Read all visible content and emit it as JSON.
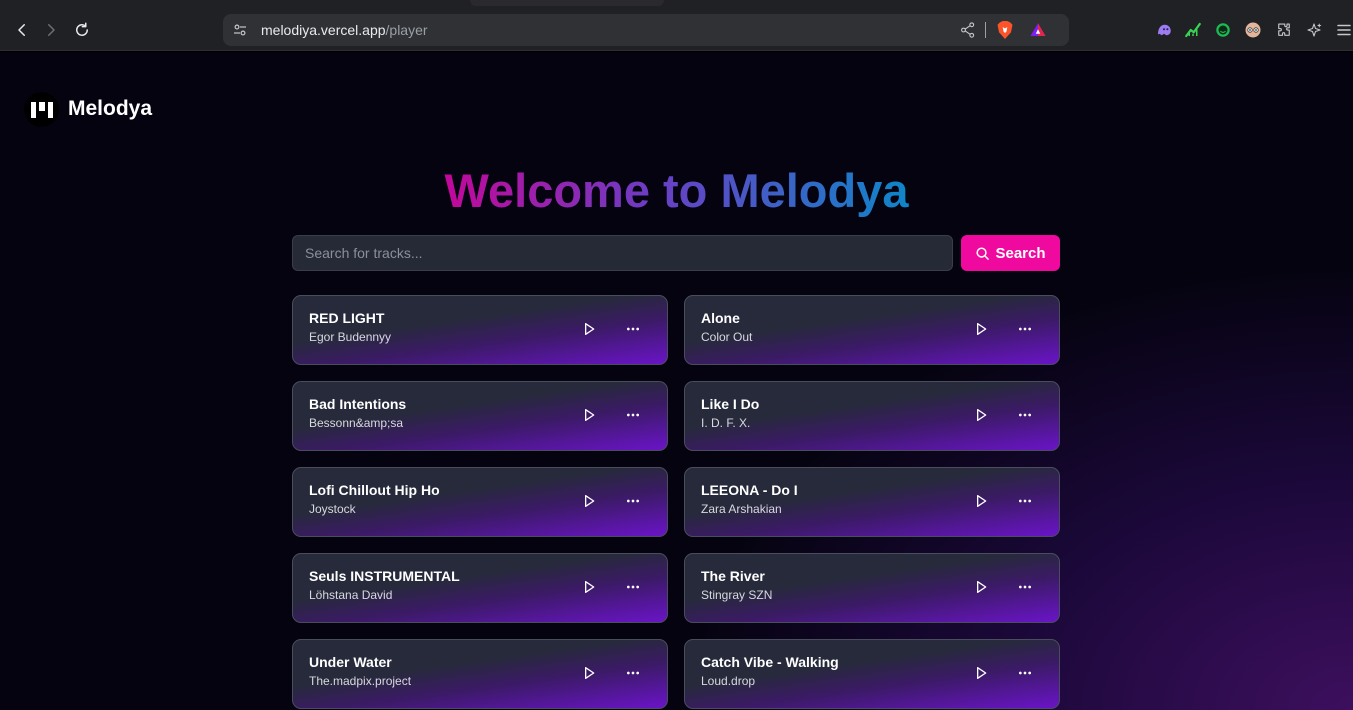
{
  "browser": {
    "url_host": "melodiya.vercel.app",
    "url_path": "/player"
  },
  "header": {
    "brand": "Melodya"
  },
  "hero": {
    "title": "Welcome to Melodya"
  },
  "search": {
    "placeholder": "Search for tracks...",
    "button_label": "Search"
  },
  "tracks": [
    {
      "title": "RED LIGHT",
      "artist": "Egor Budennyy"
    },
    {
      "title": "Alone",
      "artist": "Color Out"
    },
    {
      "title": "Bad Intentions",
      "artist": "Bessonn&amp;sa"
    },
    {
      "title": "Like I Do",
      "artist": "I. D. F. X."
    },
    {
      "title": "Lofi Chillout Hip Ho",
      "artist": "Joystock"
    },
    {
      "title": "LEEONA - Do I",
      "artist": "Zara Arshakian"
    },
    {
      "title": "Seuls INSTRUMENTAL",
      "artist": "Löhstana David"
    },
    {
      "title": "The River",
      "artist": "Stingray SZN"
    },
    {
      "title": "Under Water",
      "artist": "The.madpix.project"
    },
    {
      "title": "Catch Vibe - Walking",
      "artist": "Loud.drop"
    }
  ],
  "colors": {
    "accent": "#f0099f",
    "card_gradient_end": "#6a14c8",
    "title_gradient": [
      "#c2089a",
      "#6b3ec4",
      "#0e86c9"
    ]
  }
}
